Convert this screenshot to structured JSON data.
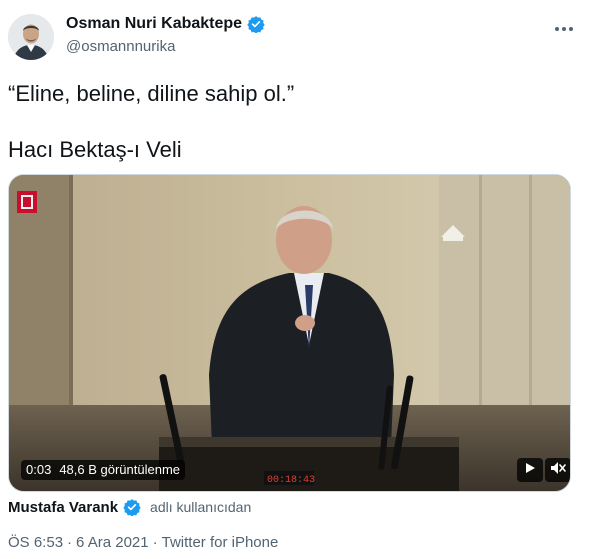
{
  "author": {
    "display_name": "Osman Nuri Kabaktepe",
    "handle": "@osmannnurika",
    "verified": true
  },
  "more_icon": "ellipsis-icon",
  "tweet": {
    "line1": "“Eline, beline, diline sahip ol.”",
    "line2": "Hacı Bektaş-ı Veli"
  },
  "video": {
    "time": "0:03",
    "views": "48,6 B görüntülenme",
    "overlay_channel_logo": "channel-logo",
    "overlay_counter": "00:18:43",
    "controls": [
      "play-icon",
      "mute-icon"
    ]
  },
  "attribution": {
    "name": "Mustafa Varank",
    "verified": true,
    "suffix": "adlı kullanıcıdan"
  },
  "meta": {
    "time": "ÖS 6:53",
    "dot": "·",
    "date": "6 Ara 2021",
    "source": "Twitter for iPhone"
  },
  "colors": {
    "verified_blue": "#1d9bf0",
    "text_primary": "#0f1419",
    "text_secondary": "#536471"
  }
}
